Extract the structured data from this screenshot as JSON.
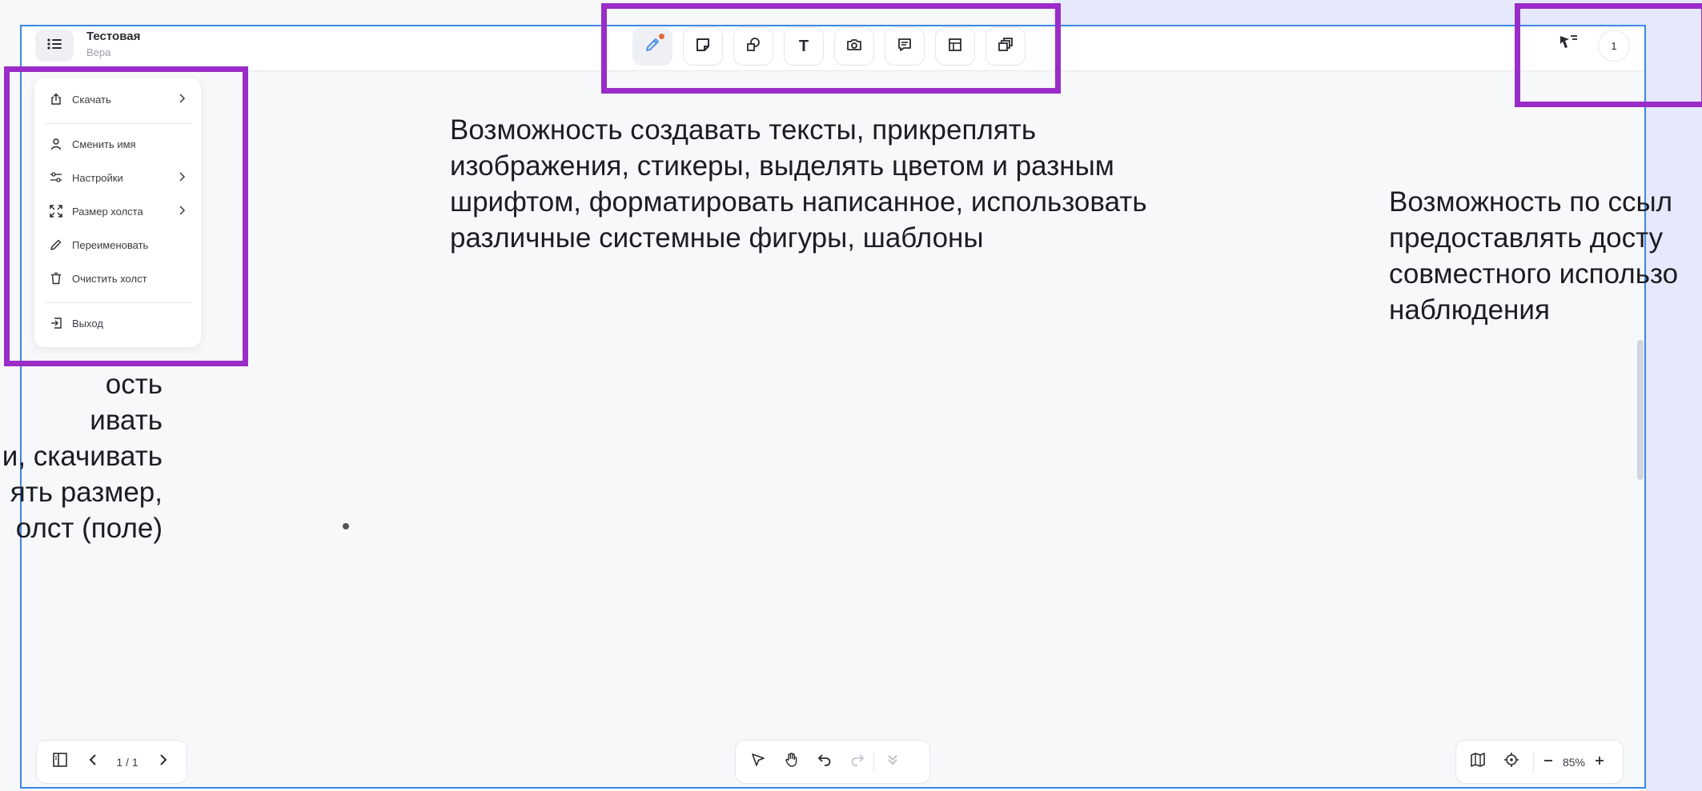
{
  "document": {
    "title": "Тестовая",
    "subtitle": "Вера"
  },
  "toolbar": {
    "tools": [
      {
        "name": "pen",
        "icon": "pen-icon",
        "active": true
      },
      {
        "name": "sticker",
        "icon": "sticky-note-icon"
      },
      {
        "name": "shapes",
        "icon": "shapes-icon"
      },
      {
        "name": "text",
        "icon": "text-icon",
        "letter": "T"
      },
      {
        "name": "image",
        "icon": "camera-icon"
      },
      {
        "name": "comment",
        "icon": "comment-icon"
      },
      {
        "name": "table",
        "icon": "table-icon"
      },
      {
        "name": "templates",
        "icon": "templates-icon"
      }
    ]
  },
  "top_right": {
    "users_count": "1"
  },
  "menu": {
    "items": [
      {
        "label": "Скачать",
        "icon": "share-icon",
        "has_submenu": true
      },
      {
        "label": "Сменить имя",
        "icon": "user-icon",
        "has_submenu": false
      },
      {
        "label": "Настройки",
        "icon": "sliders-icon",
        "has_submenu": true
      },
      {
        "label": "Размер холста",
        "icon": "resize-icon",
        "has_submenu": true
      },
      {
        "label": "Переименовать",
        "icon": "pencil-icon",
        "has_submenu": false
      },
      {
        "label": "Очистить холст",
        "icon": "trash-icon",
        "has_submenu": false
      },
      {
        "label": "Выход",
        "icon": "logout-icon",
        "has_submenu": false
      }
    ]
  },
  "annotations": {
    "center": [
      "Возможность создавать тексты, прикреплять",
      "изображения, стикеры, выделять цветом и разным",
      "шрифтом, форматировать написанное, использовать",
      "различные системные фигуры, шаблоны"
    ],
    "right": [
      "Возможность по ссыл",
      "предоставлять досту",
      "совместного использо",
      "наблюдения"
    ],
    "left": [
      "ость",
      "ивать",
      "и, скачивать",
      "ять размер,",
      "олст (поле)"
    ]
  },
  "bottom": {
    "page_indicator": "1 / 1",
    "zoom": "85%"
  },
  "colors": {
    "highlight": "#9a2cc7",
    "frame": "#3d86e8",
    "canvas": "#f7f8fa",
    "active_dot": "#e26b3a",
    "pen_active": "#3d86e8"
  }
}
